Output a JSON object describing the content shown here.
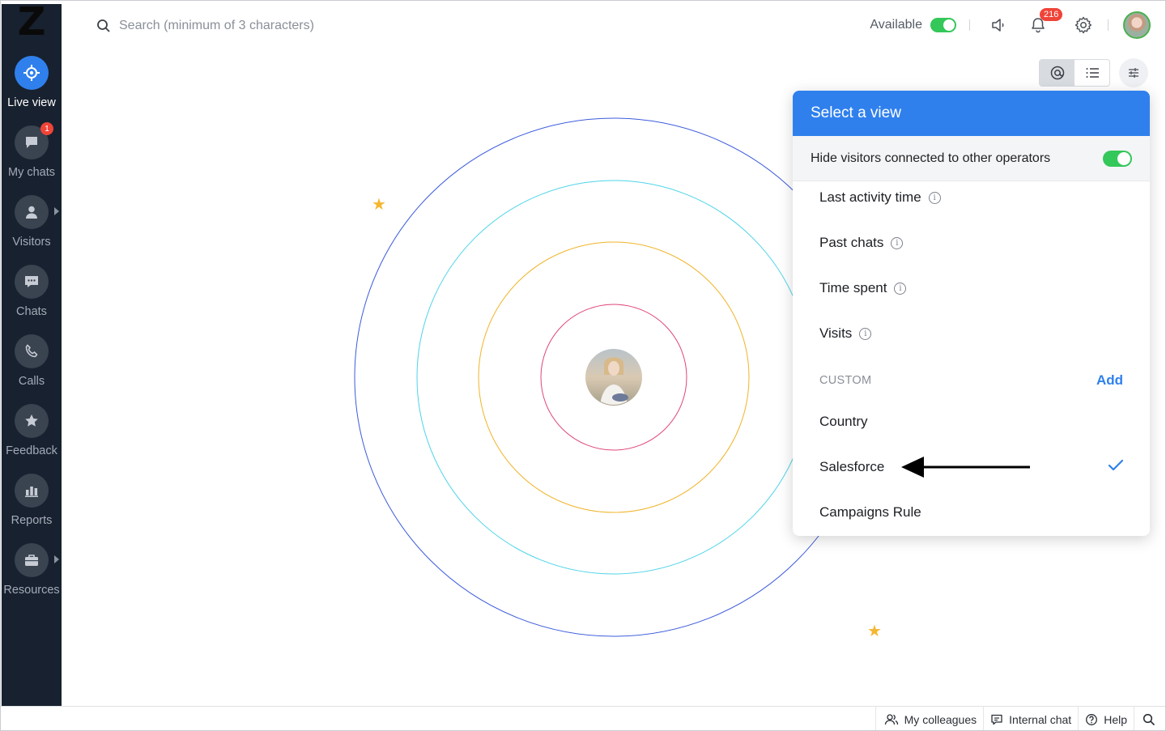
{
  "sidebar": {
    "logo": "Z",
    "items": [
      {
        "label": "Live view",
        "icon": "target-icon",
        "active": true
      },
      {
        "label": "My chats",
        "icon": "chat-bubble-icon",
        "badge": "1"
      },
      {
        "label": "Visitors",
        "icon": "user-icon",
        "has_submenu": true
      },
      {
        "label": "Chats",
        "icon": "chats-icon"
      },
      {
        "label": "Calls",
        "icon": "phone-icon"
      },
      {
        "label": "Feedback",
        "icon": "star-icon"
      },
      {
        "label": "Reports",
        "icon": "bar-chart-icon"
      },
      {
        "label": "Resources",
        "icon": "briefcase-icon",
        "has_submenu": true
      }
    ]
  },
  "header": {
    "search_placeholder": "Search (minimum of 3 characters)",
    "status_label": "Available",
    "notifications_count": "216"
  },
  "dropdown": {
    "title": "Select a view",
    "hide_label": "Hide visitors connected to other operators",
    "hide_enabled": true,
    "items": [
      {
        "label": "Last activity time",
        "info": true
      },
      {
        "label": "Past chats",
        "info": true
      },
      {
        "label": "Time spent",
        "info": true
      },
      {
        "label": "Visits",
        "info": true
      }
    ],
    "custom_section": "CUSTOM",
    "add_label": "Add",
    "custom_items": [
      {
        "label": "Country"
      },
      {
        "label": "Salesforce",
        "selected": true
      },
      {
        "label": "Campaigns Rule"
      }
    ]
  },
  "bottombar": {
    "colleagues": "My colleagues",
    "internal_chat": "Internal chat",
    "help": "Help"
  },
  "colors": {
    "accent": "#2f80ed",
    "sidebar_bg": "#18212f",
    "toggle_on": "#34c759",
    "badge": "#f04438",
    "ring_outer": "#3b5bdb",
    "ring_2": "#4dd4e8",
    "ring_3": "#f0b429",
    "ring_inner": "#e0457b",
    "star": "#f5b731"
  }
}
